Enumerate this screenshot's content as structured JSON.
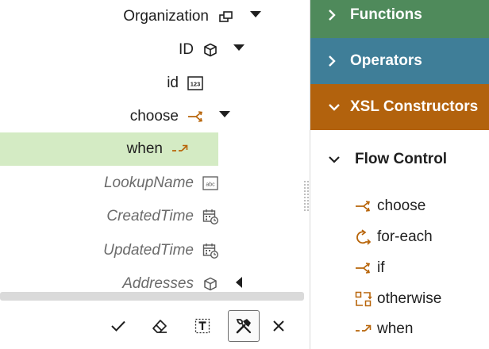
{
  "tree": {
    "nodes": [
      {
        "label": "Organization",
        "icon": "record-group-icon",
        "caret": "down"
      },
      {
        "label": "ID",
        "icon": "cube-icon",
        "caret": "down"
      },
      {
        "label": "id",
        "icon": "number-123-icon",
        "caret": "none"
      },
      {
        "label": "choose",
        "icon": "choose-icon",
        "caret": "down"
      },
      {
        "label": "when",
        "icon": "when-icon",
        "caret": "none",
        "selected": true
      },
      {
        "label": "LookupName",
        "icon": "abc-text-icon",
        "caret": "none",
        "italic": true
      },
      {
        "label": "CreatedTime",
        "icon": "calendar-clock-icon",
        "caret": "none",
        "italic": true
      },
      {
        "label": "UpdatedTime",
        "icon": "calendar-clock-icon",
        "caret": "none",
        "italic": true
      },
      {
        "label": "Addresses",
        "icon": "cube-icon",
        "caret": "left",
        "italic": true
      }
    ]
  },
  "toolbar": {
    "buttons": [
      {
        "name": "confirm",
        "icon": "check-icon"
      },
      {
        "name": "clear",
        "icon": "eraser-icon"
      },
      {
        "name": "text",
        "icon": "text-box-icon"
      },
      {
        "name": "tools",
        "icon": "tools-icon",
        "active": true
      },
      {
        "name": "close",
        "icon": "close-icon"
      }
    ]
  },
  "palette": {
    "sections": [
      {
        "label": "Functions",
        "color": "#4f8a5b",
        "expanded": false
      },
      {
        "label": "Operators",
        "color": "#3f7e98",
        "expanded": false
      },
      {
        "label": "XSL Constructors",
        "color": "#b2620d",
        "expanded": true
      }
    ],
    "group": {
      "label": "Flow Control",
      "expanded": true
    },
    "items": [
      {
        "label": "choose",
        "icon": "choose-icon"
      },
      {
        "label": "for-each",
        "icon": "for-each-icon"
      },
      {
        "label": "if",
        "icon": "if-icon"
      },
      {
        "label": "otherwise",
        "icon": "otherwise-icon"
      },
      {
        "label": "when",
        "icon": "when-icon"
      }
    ]
  },
  "colors": {
    "selection": "#d4ebc4",
    "icon_orange": "#b8650a"
  }
}
